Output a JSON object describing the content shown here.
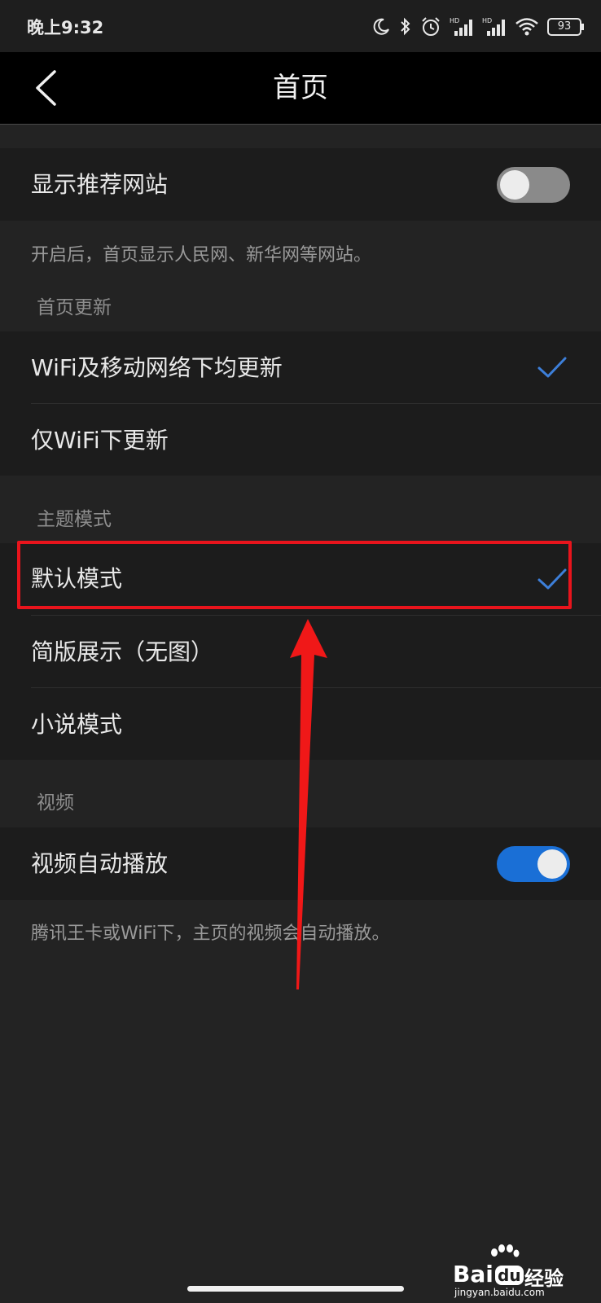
{
  "status_bar": {
    "time": "晚上9:32",
    "battery": "93",
    "icons": [
      "moon-icon",
      "bluetooth-icon",
      "alarm-icon",
      "signal-hd-icon",
      "signal-hd-icon",
      "wifi-icon",
      "battery-icon"
    ]
  },
  "header": {
    "title": "首页",
    "back_icon": "chevron-left-icon"
  },
  "recommend": {
    "label": "显示推荐网站",
    "toggle_on": false,
    "description": "开启后，首页显示人民网、新华网等网站。"
  },
  "homepage_update": {
    "group_title": "首页更新",
    "options": [
      {
        "label": "WiFi及移动网络下均更新",
        "selected": true
      },
      {
        "label": "仅WiFi下更新",
        "selected": false
      }
    ]
  },
  "theme_mode": {
    "group_title": "主题模式",
    "options": [
      {
        "label": "默认模式",
        "selected": true
      },
      {
        "label": "简版展示（无图）",
        "selected": false
      },
      {
        "label": "小说模式",
        "selected": false
      }
    ]
  },
  "video": {
    "group_title": "视频",
    "label": "视频自动播放",
    "toggle_on": true,
    "description": "腾讯王卡或WiFi下，主页的视频会自动播放。"
  },
  "watermark": {
    "brand_latin": "Bai",
    "brand_du": "du",
    "brand_cn": "经验",
    "domain": "jingyan.baidu.com"
  },
  "colors": {
    "accent_blue": "#1a6fd6",
    "check_blue": "#3d7fd9",
    "annotation_red": "#e8141c"
  }
}
